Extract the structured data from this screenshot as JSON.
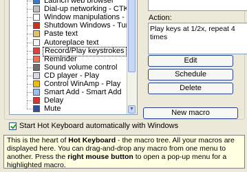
{
  "tree": {
    "items": [
      {
        "label": "Launch web browser",
        "icon": "globe-icon",
        "color": "#3c78c8"
      },
      {
        "label": "Dial-up networking - CTK",
        "icon": "network-icon",
        "color": "#c0c0c0"
      },
      {
        "label": "Window manipulations - Maximize",
        "icon": "window-icon",
        "color": "#ffffff"
      },
      {
        "label": "Shutdown Windows - Turn off the",
        "icon": "shutdown-icon",
        "color": "#d03020"
      },
      {
        "label": "Paste text",
        "icon": "clipboard-icon",
        "color": "#e0c070"
      },
      {
        "label": "Autoreplace text",
        "icon": "pen-icon",
        "color": "#f4f4f4"
      },
      {
        "label": "Record/Play keystrokes",
        "icon": "record-icon",
        "color": "#e04040"
      },
      {
        "label": "Reminder",
        "icon": "reminder-icon",
        "color": "#f07050"
      },
      {
        "label": "Sound volume control",
        "icon": "speaker-icon",
        "color": "#707070"
      },
      {
        "label": "CD player - Play",
        "icon": "cd-icon",
        "color": "#d8d8e8"
      },
      {
        "label": "Control WinAmp - Play",
        "icon": "winamp-icon",
        "color": "#f0c000"
      },
      {
        "label": "Smart Add - Smart Add",
        "icon": "smart-add-icon",
        "color": "#9ac0f0"
      },
      {
        "label": "Delay",
        "icon": "delay-icon",
        "color": "#e03030"
      },
      {
        "label": "Mute",
        "icon": "mute-icon",
        "color": "#3050a0"
      }
    ],
    "selected_index": 6
  },
  "action": {
    "label": "Action:",
    "text": "Play keys at 1/2x, repeat 4 times"
  },
  "buttons": {
    "edit": "Edit",
    "schedule": "Schedule",
    "delete": "Delete",
    "new_macro": "New macro"
  },
  "autostart": {
    "label": "Start Hot Keyboard automatically with Windows",
    "checked": true
  },
  "help": {
    "t1": "This is the heart of ",
    "b1": "Hot Keyboard",
    "t2": " - the macro tree. All your macros are displayed here. You can drag-and-drop any macro from one menu to another. Press the ",
    "b2": "right mouse button",
    "t3": " to open a pop-up menu for a highlighted macro."
  },
  "colors": {
    "window_bg": "#ece9d8",
    "help_bg": "#ffffe1",
    "field_border": "#7f9db9",
    "button_border": "#23408c"
  }
}
